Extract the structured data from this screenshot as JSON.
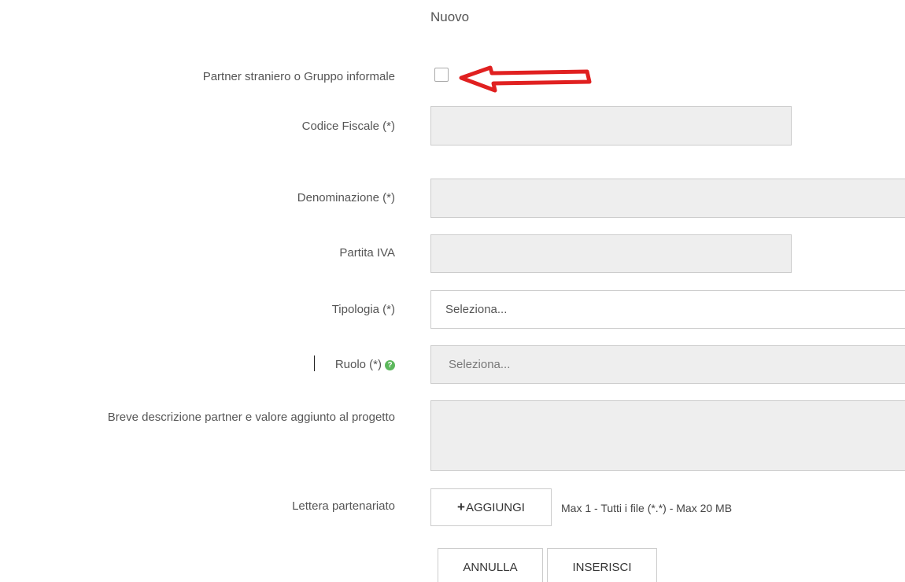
{
  "form": {
    "title": "Nuovo",
    "partner_label": "Partner straniero o Gruppo informale",
    "codice_fiscale_label": "Codice Fiscale (*)",
    "denominazione_label": "Denominazione (*)",
    "partita_iva_label": "Partita IVA",
    "tipologia_label": "Tipologia (*)",
    "tipologia_value": "Seleziona...",
    "ruolo_label": "Ruolo (*)",
    "ruolo_value": "Seleziona...",
    "descrizione_label": "Breve descrizione partner e valore aggiunto al progetto",
    "lettera_label": "Lettera partenariato",
    "add_button_label": "AGGIUNGI",
    "add_button_icon": "+",
    "file_info": "Max 1 - Tutti i file (*.*) - Max 20 MB",
    "help_icon": "?"
  },
  "actions": {
    "annulla_label": "ANNULLA",
    "inserisci_label": "INSERISCI"
  },
  "colors": {
    "arrow": "#e02020",
    "help_icon": "#5cb85c"
  },
  "icons": {
    "arrow": "red-arrow-pointing-left",
    "help": "question-circle-icon",
    "add": "plus-icon"
  }
}
